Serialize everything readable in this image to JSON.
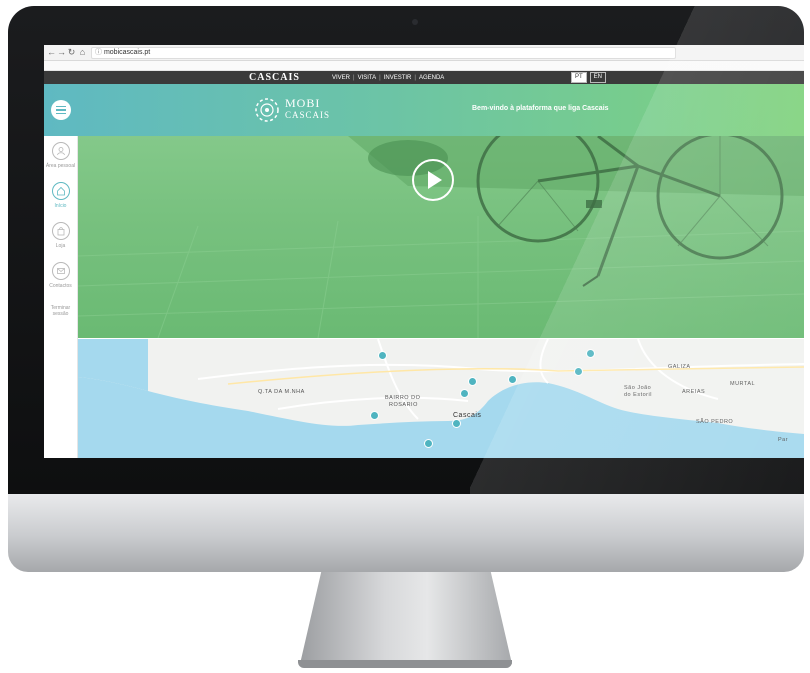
{
  "browser": {
    "url": "mobicascais.pt",
    "nav_icons": [
      "back-arrow-icon",
      "forward-arrow-icon",
      "reload-icon",
      "home-icon",
      "info-icon"
    ]
  },
  "municipal_bar": {
    "logo": "CASCAIS",
    "nav": [
      "VIVER",
      "VISITA",
      "INVESTIR",
      "AGENDA"
    ],
    "separator": "|",
    "languages": [
      {
        "label": "PT",
        "active": true
      },
      {
        "label": "EN",
        "active": false
      }
    ]
  },
  "header": {
    "logo_line1": "MOBI",
    "logo_line2": "CASCAIS",
    "welcome": "Bem-vindo à plataforma que liga Cascais",
    "menu_icon": "hamburger-menu-icon"
  },
  "sidebar": {
    "items": [
      {
        "label": "Área pessoal",
        "icon": "user-icon",
        "active": false
      },
      {
        "label": "Início",
        "icon": "home-icon",
        "active": true
      },
      {
        "label": "Loja",
        "icon": "shopping-bag-icon",
        "active": false
      },
      {
        "label": "Contactos",
        "icon": "envelope-icon",
        "active": false
      }
    ],
    "logout": "Terminar sessão"
  },
  "hero": {
    "play_icon": "play-icon"
  },
  "map": {
    "labels": [
      {
        "text": "GALIZA"
      },
      {
        "text": "MURTAL"
      },
      {
        "text": "AREIAS"
      },
      {
        "text": "Q.TA DA M.NHA"
      },
      {
        "text": "BAIRRO DO"
      },
      {
        "text": "ROSARIO"
      },
      {
        "text": "Cascais"
      },
      {
        "text": "São João"
      },
      {
        "text": "do Estoril"
      },
      {
        "text": "SÃO PEDRO"
      },
      {
        "text": "Par"
      }
    ]
  },
  "colors": {
    "teal": "#5fb9c2",
    "green": "#7fd27c",
    "hero_green": "#78c17f",
    "sea": "#a5d9ee",
    "dark_bar": "#3a3a3a"
  }
}
